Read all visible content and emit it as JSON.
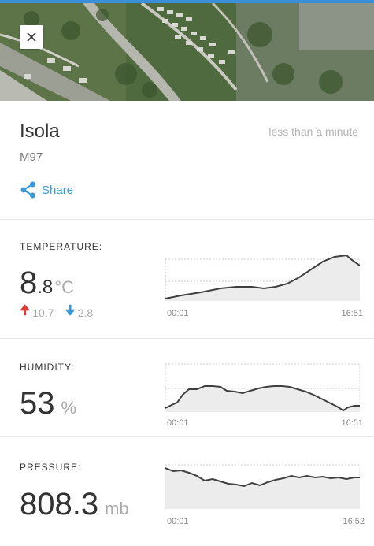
{
  "station": {
    "name": "Isola",
    "code": "M97",
    "updated": "less than a minute",
    "share_label": "Share"
  },
  "close_icon": "close-icon",
  "share_icon": "share-icon",
  "colors": {
    "accent": "#3a9ad9",
    "up_arrow": "#e03b3b",
    "down_arrow": "#3a9ad9",
    "chart_line": "#404040",
    "chart_fill": "#ececec"
  },
  "temperature": {
    "title": "TEMPERATURE:",
    "value_int": "8",
    "value_dec": ".8",
    "unit": "°C",
    "max": "10.7",
    "min": "2.8",
    "time_start": "00:01",
    "time_end": "16:51"
  },
  "humidity": {
    "title": "HUMIDITY:",
    "value": "53",
    "unit": "%",
    "time_start": "00:01",
    "time_end": "16:51"
  },
  "pressure": {
    "title": "PRESSURE:",
    "value": "808.3",
    "unit": "mb",
    "time_start": "00:01",
    "time_end": "16:52"
  }
}
